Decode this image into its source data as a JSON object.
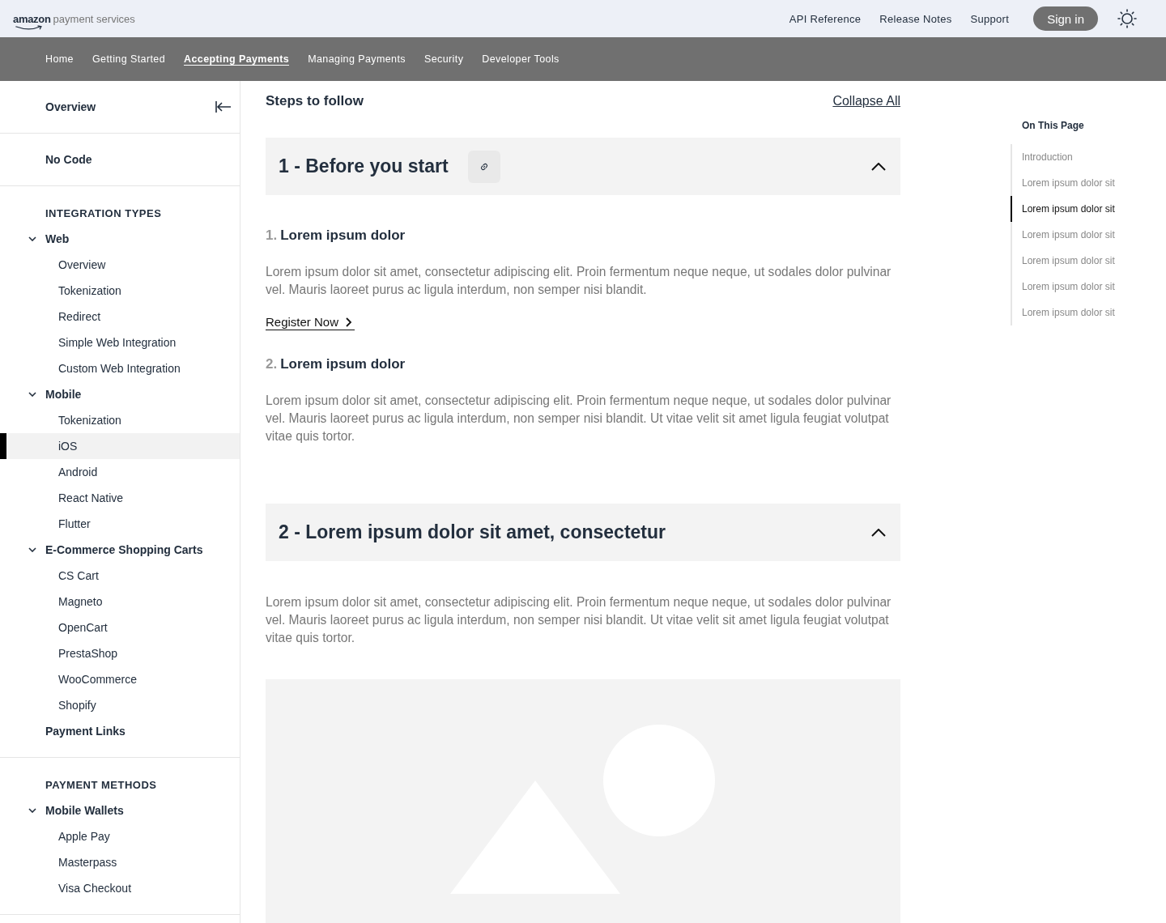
{
  "header": {
    "logo": {
      "brand": "amazon",
      "product": "payment services"
    },
    "links": [
      "API Reference",
      "Release Notes",
      "Support"
    ],
    "sign_in": "Sign in"
  },
  "nav": [
    {
      "label": "Home",
      "selected": false
    },
    {
      "label": "Getting Started",
      "selected": false
    },
    {
      "label": "Accepting Payments",
      "selected": true
    },
    {
      "label": "Managing Payments",
      "selected": false
    },
    {
      "label": "Security",
      "selected": false
    },
    {
      "label": "Developer Tools",
      "selected": false
    }
  ],
  "sidebar": {
    "overview": "Overview",
    "no_code": "No Code",
    "sections": [
      {
        "heading": "INTEGRATION TYPES",
        "items": [
          {
            "label": "Web",
            "expanded": true,
            "children": [
              {
                "label": "Overview",
                "selected": false
              },
              {
                "label": "Tokenization",
                "selected": false
              },
              {
                "label": "Redirect",
                "selected": false
              },
              {
                "label": "Simple Web Integration",
                "selected": false
              },
              {
                "label": "Custom Web Integration",
                "selected": false
              }
            ]
          },
          {
            "label": "Mobile",
            "expanded": true,
            "children": [
              {
                "label": "Tokenization",
                "selected": false
              },
              {
                "label": "iOS",
                "selected": true
              },
              {
                "label": "Android",
                "selected": false
              },
              {
                "label": "React Native",
                "selected": false
              },
              {
                "label": "Flutter",
                "selected": false
              }
            ]
          },
          {
            "label": "E-Commerce Shopping Carts",
            "expanded": true,
            "children": [
              {
                "label": "CS Cart",
                "selected": false
              },
              {
                "label": "Magneto",
                "selected": false
              },
              {
                "label": "OpenCart",
                "selected": false
              },
              {
                "label": "PrestaShop",
                "selected": false
              },
              {
                "label": "WooCommerce",
                "selected": false
              },
              {
                "label": "Shopify",
                "selected": false
              }
            ]
          },
          {
            "label": "Payment Links"
          }
        ]
      },
      {
        "heading": "PAYMENT METHODS",
        "items": [
          {
            "label": "Mobile Wallets",
            "expanded": true,
            "children": [
              {
                "label": "Apple Pay",
                "selected": false
              },
              {
                "label": "Masterpass",
                "selected": false
              },
              {
                "label": "Visa Checkout",
                "selected": false
              }
            ]
          }
        ]
      }
    ]
  },
  "content": {
    "title": "Steps to follow",
    "collapse_all": "Collapse All",
    "accordions": [
      {
        "title": "1 - Before you start",
        "link_button": true,
        "expanded": true,
        "image_placeholder": false,
        "steps": [
          {
            "number": "1.",
            "title": "Lorem ipsum dolor",
            "text": "Lorem ipsum dolor sit amet, consectetur adipiscing elit. Proin fermentum neque neque, ut sodales dolor pulvinar vel. Mauris laoreet purus ac ligula interdum, non semper nisi blandit.",
            "link": "Register Now"
          },
          {
            "number": "2.",
            "title": "Lorem ipsum dolor",
            "text": "Lorem ipsum dolor sit amet, consectetur adipiscing elit. Proin fermentum neque neque, ut sodales dolor pulvinar vel. Mauris laoreet purus ac ligula interdum, non semper nisi blandit. Ut vitae velit sit amet ligula feugiat volutpat vitae quis tortor."
          }
        ]
      },
      {
        "title": "2 - Lorem ipsum dolor sit amet, consectetur",
        "link_button": false,
        "expanded": true,
        "text": "Lorem ipsum dolor sit amet, consectetur adipiscing elit. Proin fermentum neque neque, ut sodales dolor pulvinar vel. Mauris laoreet purus ac ligula interdum, non semper nisi blandit. Ut vitae velit sit amet ligula feugiat volutpat vitae quis tortor.",
        "image_placeholder": true
      }
    ]
  },
  "toc": {
    "title": "On This Page",
    "items": [
      {
        "label": "Introduction",
        "selected": false
      },
      {
        "label": "Lorem ipsum dolor sit",
        "selected": false
      },
      {
        "label": "Lorem ipsum dolor sit",
        "selected": true
      },
      {
        "label": "Lorem ipsum dolor sit",
        "selected": false
      },
      {
        "label": "Lorem ipsum dolor sit",
        "selected": false
      },
      {
        "label": "Lorem ipsum dolor sit",
        "selected": false
      },
      {
        "label": "Lorem ipsum dolor sit",
        "selected": false
      }
    ]
  }
}
